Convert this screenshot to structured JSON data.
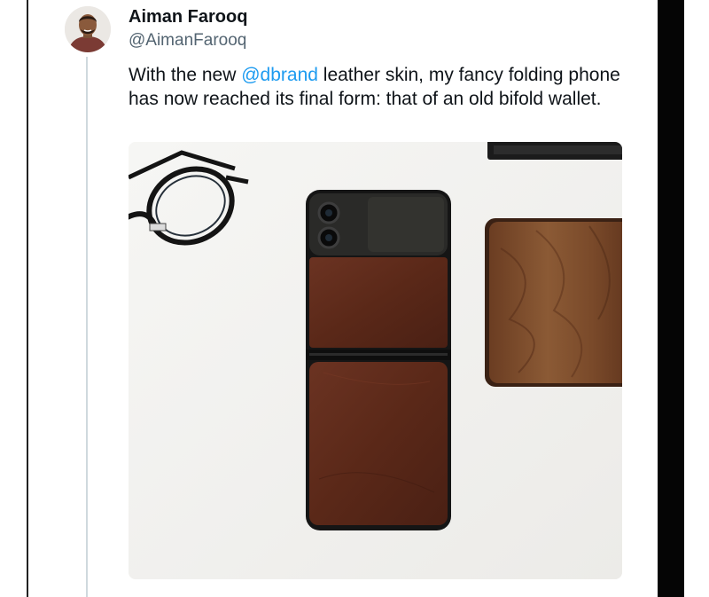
{
  "author": {
    "name": "Aiman Farooq",
    "handle": "@AimanFarooq"
  },
  "tweet": {
    "text_before": "With the new ",
    "mention": "@dbrand",
    "text_after": " leather skin, my fancy folding phone has now reached its final form: that of an old bifold wallet."
  },
  "colors": {
    "link": "#1d9bf0",
    "leather": "#5a2a1a",
    "wood": "#7a4a2a"
  }
}
